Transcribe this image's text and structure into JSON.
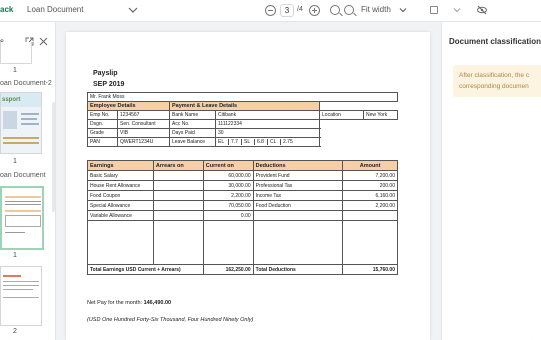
{
  "toolbar": {
    "back_label": "ack",
    "document_name": "Loan Document",
    "page_current": "3",
    "page_total": "/4",
    "fit_label": "Fit width"
  },
  "thumbs": {
    "title": "s",
    "items": [
      {
        "num": "1",
        "caption": "oan Document-2"
      },
      {
        "num": "1",
        "caption": "oan Document"
      },
      {
        "num": "1",
        "caption": ""
      },
      {
        "num": "2",
        "caption": ""
      }
    ],
    "passport_text": "ssport"
  },
  "payslip": {
    "title": "Payslip",
    "month": "SEP 2019",
    "employee_name": "Mr. Frank Moss",
    "employee_header": "Employee Details",
    "payment_header": "Payment & Leave Details",
    "rows": [
      {
        "k1": "Emp No.",
        "v1": "1234567",
        "k2": "Bank Name",
        "v2": "Citibank",
        "k3": "Location",
        "v3": "New York"
      },
      {
        "k1": "Dsgn.",
        "v1": "Sen. Consultant",
        "k2": "Acc No.",
        "v2": "111122334"
      },
      {
        "k1": "Grade",
        "v1": "VIB",
        "k2": "Days Paid",
        "v2": "30"
      },
      {
        "k1": "PAN",
        "v1": "QWERT1234U",
        "k2": "Leave Balance",
        "el": "EL",
        "elv": "7.7",
        "sl": "SL",
        "slv": "6.8",
        "cl": "CL",
        "clv": "2.75"
      }
    ],
    "earnings_header": "Earnings",
    "arrears_header": "Arrears on",
    "current_header": "Current on",
    "deductions_header": "Deductions",
    "amount_header": "Amount",
    "earnings": [
      {
        "label": "Basic Salary",
        "current": "60,000.00"
      },
      {
        "label": "House Rent Allowance",
        "current": "30,000.00"
      },
      {
        "label": "Food Coupon",
        "current": "2,200.00"
      },
      {
        "label": "Special Allowance",
        "current": "70,050.00"
      },
      {
        "label": "Variable Allowance",
        "current": "0.00"
      }
    ],
    "deductions": [
      {
        "label": "Provident Fund",
        "amount": "7,200.00"
      },
      {
        "label": "Professional Tax",
        "amount": "200.00"
      },
      {
        "label": "Income Tax",
        "amount": "6,160.00"
      },
      {
        "label": "Food Deduction",
        "amount": "2,200.00"
      }
    ],
    "total_earnings_label": "Total Earnings USD Current + Arrears)",
    "total_earnings_value": "162,250.00",
    "total_deductions_label": "Total Deductions",
    "total_deductions_value": "15,760.00",
    "net_pay_label": "Net Pay for the month:",
    "net_pay_value": "146,490.00",
    "net_pay_words": "(USD One Hundred Forty-Six Thousand, Four Hundred Ninety Only)"
  },
  "right_panel": {
    "title": "Document classification",
    "note_line1": "After classification, the c",
    "note_line2": "corresponding documen"
  },
  "colors": {
    "header_orange": "#f6cfa7",
    "note_bg": "#fdf3e1",
    "selected_thumb_border": "#9ed3b5"
  }
}
